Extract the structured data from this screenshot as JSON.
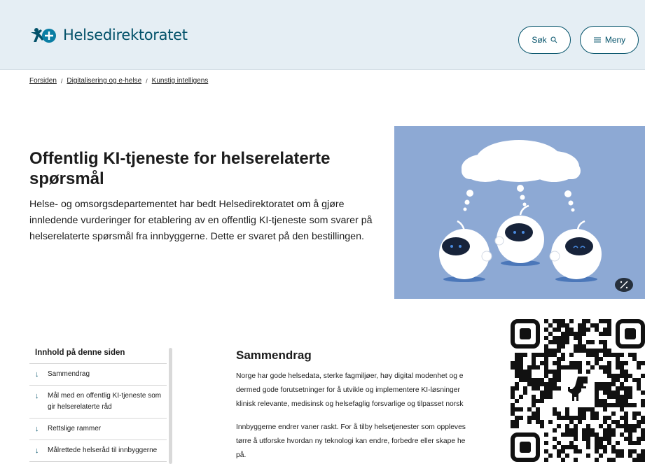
{
  "header": {
    "brand": "Helsedirektoratet",
    "search_label": "Søk",
    "menu_label": "Meny"
  },
  "breadcrumb": {
    "items": [
      "Forsiden",
      "Digitalisering og e-helse",
      "Kunstig intelligens"
    ],
    "separator": "/"
  },
  "hero": {
    "title": "Offentlig KI-tjeneste for helserelaterte spørsmål",
    "lead": "Helse- og omsorgsdepartementet har bedt Helsedirektoratet om å gjøre innledende vurderinger for etablering av en offentlig KI-tjeneste som svarer på helserelaterte spørsmål fra innbyggerne. Dette er svaret på den bestillingen."
  },
  "toc": {
    "title": "Innhold på denne siden",
    "items": [
      "Sammendrag",
      "Mål med en offentlig KI-tjeneste som gir helserelaterte råd",
      "Rettslige rammer",
      "Målrettede helseråd til innbyggerne"
    ]
  },
  "content": {
    "section_title": "Sammendrag",
    "p1_lines": [
      "Norge har gode helsedata, sterke fagmiljøer, høy digital modenhet og e",
      "dermed gode forutsetninger for å utvikle og implementere KI-løsninger",
      "klinisk relevante, medisinsk og helsefaglig forsvarlige og tilpasset norsk"
    ],
    "p2_lines": [
      "Innbyggerne endrer vaner raskt. For å tilby helsetjenester som oppleves",
      "tørre å utforske hvordan ny teknologi kan endre, forbedre eller skape he",
      "på."
    ]
  },
  "colors": {
    "brand": "#025169",
    "header_bg": "#e5eef4",
    "hero_bg": "#8da9d4"
  },
  "icons": [
    "helsedirektoratet-logo-icon",
    "search-icon",
    "menu-icon",
    "arrow-down-icon",
    "magic-wand-icon",
    "qr-code"
  ]
}
